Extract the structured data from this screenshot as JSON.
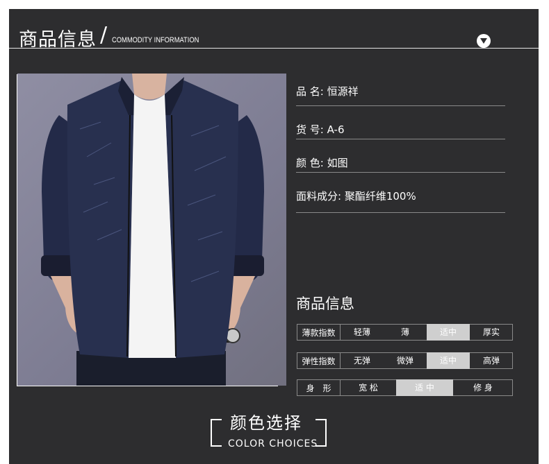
{
  "header": {
    "title_zh": "商品信息",
    "slash": "/",
    "title_en": "COMMODITY INFORMATION"
  },
  "image": {
    "description_icon": "jacket-photo"
  },
  "specs": [
    {
      "label": "品 名:",
      "value": "恒源祥"
    },
    {
      "label": "货 号:",
      "value": "A-6"
    },
    {
      "label": "颜 色:",
      "value": "如图"
    },
    {
      "label": "面料成分:",
      "value": "聚酯纤维100%"
    }
  ],
  "product_info": {
    "title": "商品信息",
    "rows": [
      {
        "header": "薄款指数",
        "options": [
          "轻薄",
          "薄",
          "适中",
          "厚实"
        ],
        "selected": "适中"
      },
      {
        "header": "弹性指数",
        "options": [
          "无弹",
          "微弹",
          "适中",
          "高弹"
        ],
        "selected": "适中"
      },
      {
        "header": "身　形",
        "options": [
          "宽 松",
          "适 中",
          "修 身"
        ],
        "selected": "适 中"
      }
    ]
  },
  "color_choices": {
    "title_zh": "颜色选择",
    "title_en": "COLOR  CHOICES"
  },
  "colors": {
    "panel": "#2d2d2f",
    "highlight": "#cfcfcf",
    "text": "#ffffff"
  }
}
